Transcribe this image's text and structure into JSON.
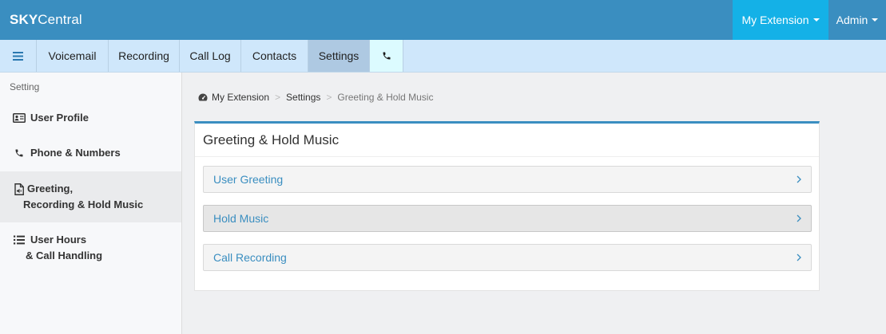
{
  "header": {
    "brand_bold": "SKY",
    "brand_rest": "Central",
    "extension_label": "My Extension",
    "admin_label": "Admin"
  },
  "subnav": {
    "tabs": [
      {
        "label": "Voicemail"
      },
      {
        "label": "Recording"
      },
      {
        "label": "Call Log"
      },
      {
        "label": "Contacts"
      },
      {
        "label": "Settings",
        "active": true
      }
    ],
    "phone_icon": "phone-icon",
    "menu_icon": "hamburger-icon"
  },
  "sidebar": {
    "title": "Setting",
    "items": [
      {
        "line1": "User Profile",
        "line2": "",
        "icon": "id-card-icon"
      },
      {
        "line1": "Phone & Numbers",
        "line2": "",
        "icon": "phone-icon"
      },
      {
        "line1": "Greeting,",
        "line2": "Recording & Hold Music",
        "icon": "audio-file-icon",
        "active": true
      },
      {
        "line1": "User Hours",
        "line2": "& Call Handling",
        "icon": "list-icon"
      }
    ]
  },
  "breadcrumb": {
    "home": "My Extension",
    "level2": "Settings",
    "current": "Greeting & Hold Music",
    "separator": ">"
  },
  "panel": {
    "title": "Greeting & Hold Music",
    "items": [
      {
        "label": "User Greeting"
      },
      {
        "label": "Hold Music"
      },
      {
        "label": "Call Recording"
      }
    ]
  },
  "colors": {
    "header": "#3a8ec0",
    "extension_button": "#14b1e7",
    "subnav": "#cfe7fb",
    "link": "#3a8ec0"
  }
}
